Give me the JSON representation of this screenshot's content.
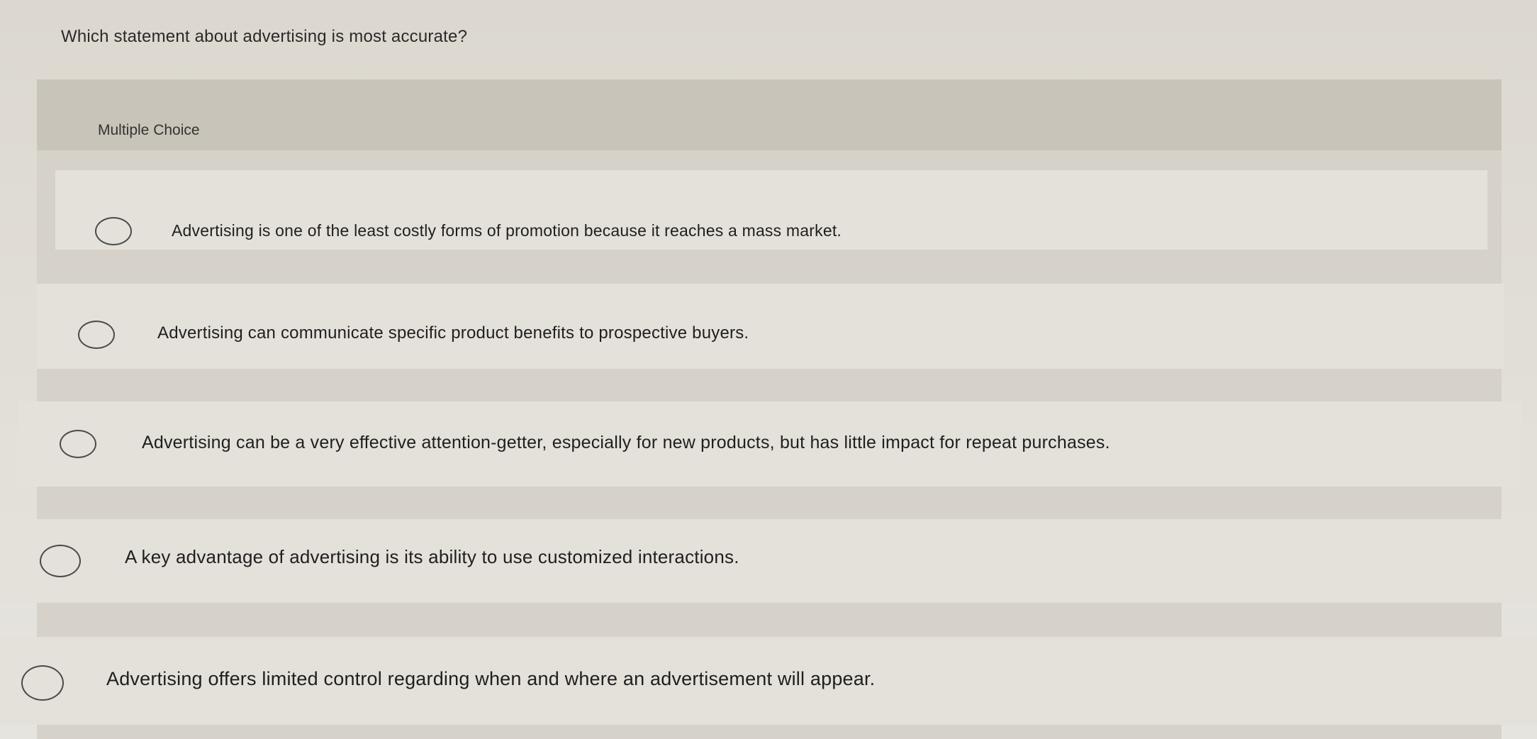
{
  "question": "Which statement about advertising is most accurate?",
  "question_type_label": "Multiple Choice",
  "options": [
    {
      "label": "Advertising is one of the least costly forms of promotion because it reaches a mass market.",
      "selected": false
    },
    {
      "label": "Advertising can communicate specific product benefits to prospective buyers.",
      "selected": false
    },
    {
      "label": "Advertising can be a very effective attention-getter, especially for new products, but has little impact for repeat purchases.",
      "selected": false
    },
    {
      "label": "A key advantage of advertising is its ability to use customized interactions.",
      "selected": false
    },
    {
      "label": "Advertising offers limited control regarding when and where an advertisement will appear.",
      "selected": false
    }
  ]
}
